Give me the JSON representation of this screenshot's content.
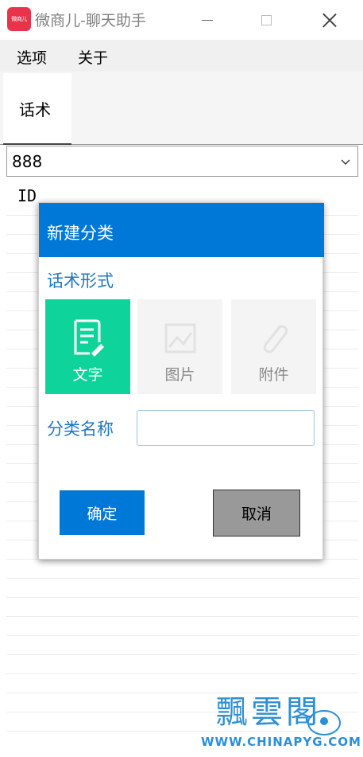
{
  "window": {
    "logo_text": "微商儿",
    "title": "微商儿-聊天助手"
  },
  "menu": {
    "options": "选项",
    "about": "关于"
  },
  "tabs": [
    {
      "label": "话术",
      "active": true
    }
  ],
  "combo": {
    "value": "888"
  },
  "list": {
    "header": "ID"
  },
  "dialog": {
    "title": "新建分类",
    "section_label": "话术形式",
    "types": [
      {
        "label": "文字",
        "icon": "document-edit-icon",
        "selected": true
      },
      {
        "label": "图片",
        "icon": "image-icon",
        "selected": false
      },
      {
        "label": "附件",
        "icon": "paperclip-icon",
        "selected": false
      }
    ],
    "name_label": "分类名称",
    "name_value": "",
    "confirm_label": "确定",
    "cancel_label": "取消"
  },
  "watermark": {
    "title": "飄雲閣",
    "url": "WWW.CHINAPYG.COM"
  },
  "colors": {
    "accent": "#0078d7",
    "selected_card": "#0ed39a",
    "label_blue": "#1e78c2",
    "cancel_gray": "#999999"
  }
}
